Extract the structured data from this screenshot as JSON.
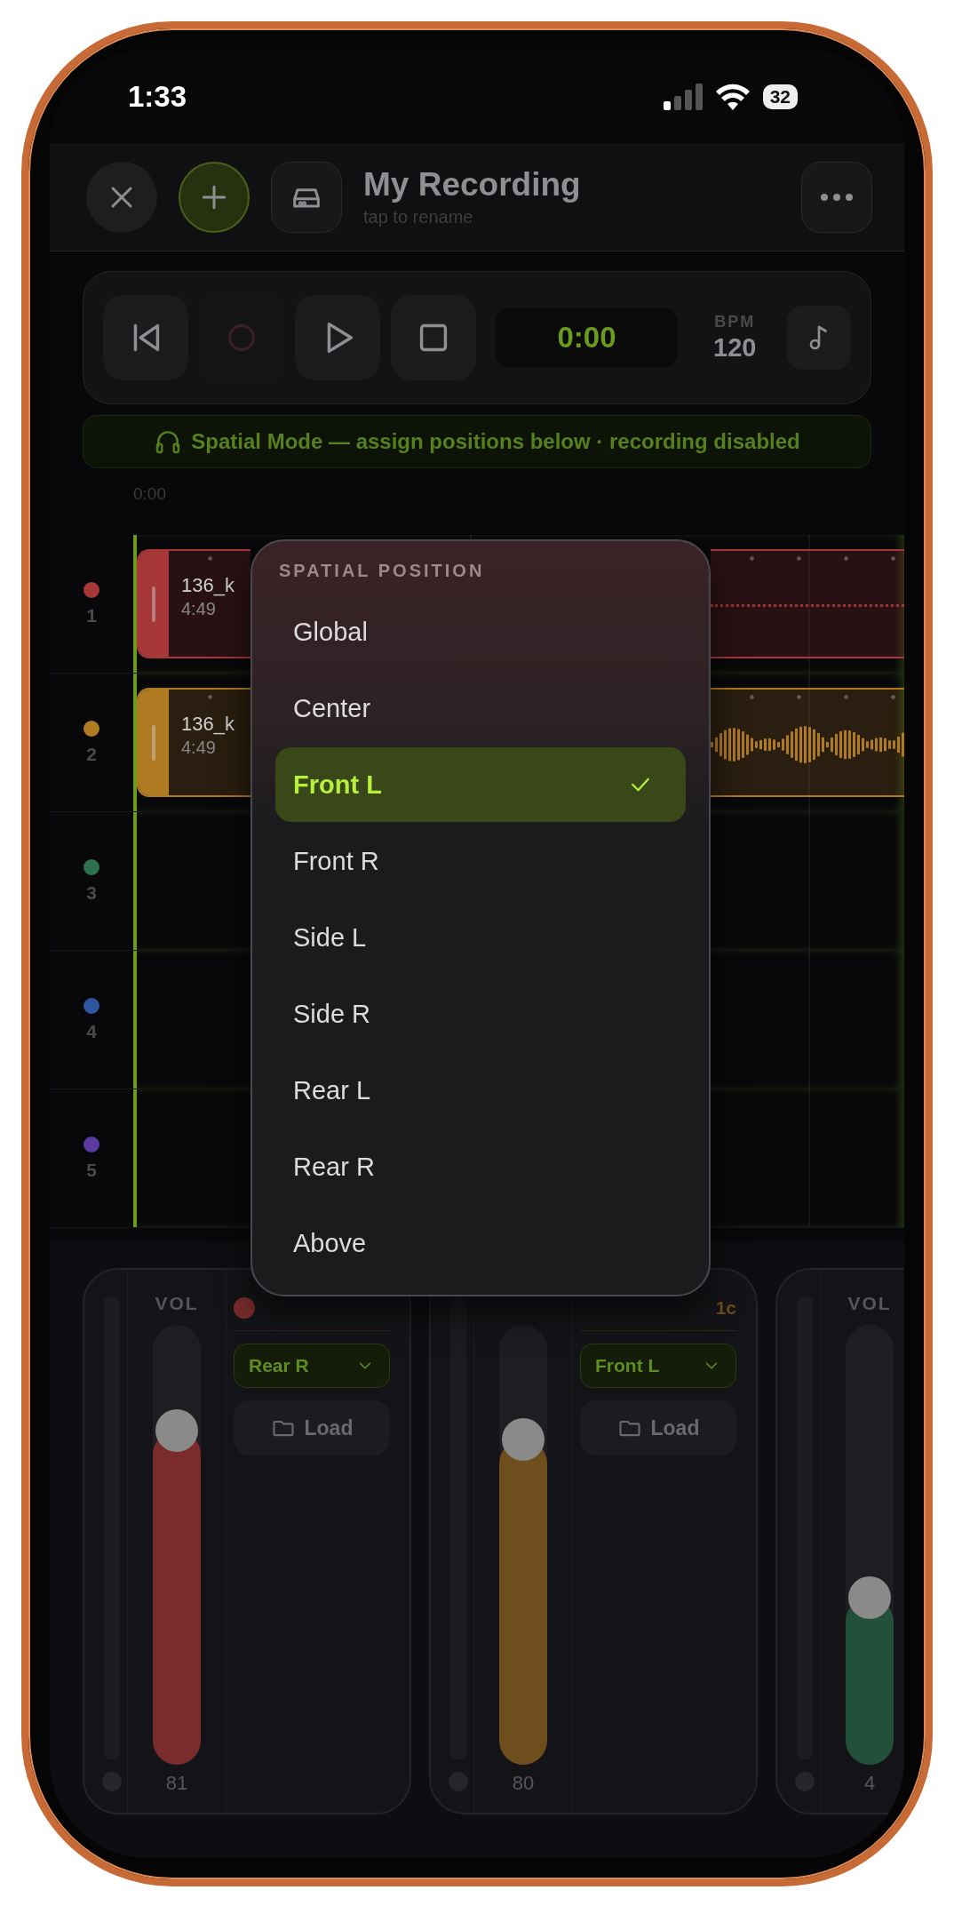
{
  "status_bar": {
    "time": "1:33",
    "battery": "32"
  },
  "header": {
    "title": "My Recording",
    "subtitle": "tap to rename"
  },
  "transport": {
    "recording_enabled": false,
    "time": "0:00",
    "bpm_label": "BPM",
    "bpm": "120"
  },
  "banner": "Spatial Mode — assign positions below · recording disabled",
  "ruler": [
    "0:00"
  ],
  "tracks": [
    {
      "number": "1",
      "color": "#a83838",
      "clip": {
        "kind": "flat",
        "name": "136_k",
        "duration": "4:49"
      }
    },
    {
      "number": "2",
      "color": "#b07a22",
      "clip": {
        "kind": "wave",
        "name": "136_k",
        "duration": "4:49"
      }
    },
    {
      "number": "3",
      "color": "#2e7050"
    },
    {
      "number": "4",
      "color": "#2f55a0"
    },
    {
      "number": "5",
      "color": "#5a3aa0"
    }
  ],
  "menu": {
    "title": "SPATIAL POSITION",
    "items": [
      {
        "label": "Global",
        "selected": false
      },
      {
        "label": "Center",
        "selected": false
      },
      {
        "label": "Front L",
        "selected": true
      },
      {
        "label": "Front R",
        "selected": false
      },
      {
        "label": "Side L",
        "selected": false
      },
      {
        "label": "Side R",
        "selected": false
      },
      {
        "label": "Rear L",
        "selected": false
      },
      {
        "label": "Rear R",
        "selected": false
      },
      {
        "label": "Above",
        "selected": false
      }
    ]
  },
  "mixer": [
    {
      "color": "#7a2c2c",
      "dot": true,
      "vol_label": "VOL",
      "position": "Rear R",
      "load": "Load",
      "level": 0.76,
      "reading": "81"
    },
    {
      "color": "#6e4e1c",
      "channels": "1c",
      "position": "Front L",
      "load": "Load",
      "level": 0.74,
      "reading": "80"
    },
    {
      "color": "#22503a",
      "vol_label": "VOL",
      "level": 0.38,
      "reading": "4"
    }
  ]
}
